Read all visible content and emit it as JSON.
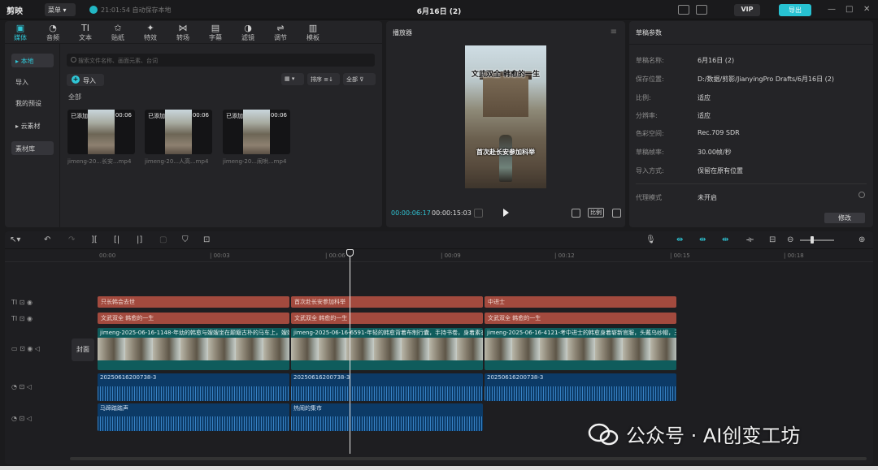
{
  "app": {
    "logo": "剪映",
    "menu": "菜单",
    "save_status": "21:01:54 自动保存本地",
    "title": "6月16日 (2)",
    "vip": "VIP",
    "export": "导出",
    "minimize": "—",
    "maximize": "□",
    "close": "✕"
  },
  "tools": [
    {
      "label": "媒体",
      "icon": "▣"
    },
    {
      "label": "音频",
      "icon": "◔"
    },
    {
      "label": "文本",
      "icon": "TI"
    },
    {
      "label": "贴纸",
      "icon": "✩"
    },
    {
      "label": "特效",
      "icon": "✦"
    },
    {
      "label": "转场",
      "icon": "⋈"
    },
    {
      "label": "字幕",
      "icon": "▤"
    },
    {
      "label": "滤镜",
      "icon": "◑"
    },
    {
      "label": "调节",
      "icon": "⇌"
    },
    {
      "label": "模板",
      "icon": "▥"
    }
  ],
  "sidebar": {
    "local": "本地",
    "import": "导入",
    "presets": "我的预设",
    "cloud": "云素材",
    "library": "素材库"
  },
  "media": {
    "search_placeholder": "搜索文件名称、画面元素、台词",
    "import_btn": "导入",
    "sort": "排序",
    "all_filter": "全部",
    "category": "全部",
    "clips": [
      {
        "added": "已添加",
        "duration": "00:06",
        "name": "jimeng-20...长安...mp4"
      },
      {
        "added": "已添加",
        "duration": "00:06",
        "name": "jimeng-20...人高...mp4"
      },
      {
        "added": "已添加",
        "duration": "00:06",
        "name": "jimeng-20...闹哄...mp4"
      }
    ]
  },
  "player": {
    "title": "播放器",
    "overlay_title": "文武双全  韩愈的一生",
    "overlay_sub": "首次赴长安参加科举",
    "current_time": "00:00:06:17",
    "total_time": "00:00:15:03",
    "ratio": "比例"
  },
  "draft": {
    "title": "草稿参数",
    "rows": [
      {
        "label": "草稿名称:",
        "value": "6月16日 (2)"
      },
      {
        "label": "保存位置:",
        "value": "D:/数据/剪影/JianyingPro Drafts/6月16日 (2)"
      },
      {
        "label": "比例:",
        "value": "适应"
      },
      {
        "label": "分辨率:",
        "value": "适应"
      },
      {
        "label": "色彩空间:",
        "value": "Rec.709 SDR"
      },
      {
        "label": "草稿帧率:",
        "value": "30.00帧/秒"
      },
      {
        "label": "导入方式:",
        "value": "保留在原有位置"
      }
    ],
    "proxy_label": "代理模式",
    "proxy_value": "未开启",
    "modify_btn": "修改"
  },
  "timeline": {
    "ticks": [
      "00:00",
      "| 00:03",
      "| 00:06",
      "| 00:09",
      "| 00:12",
      "| 00:15",
      "| 00:18"
    ],
    "cover": "封面",
    "text_track_1": [
      "只长韩会去世",
      "首次赴长安参加科举",
      "中进士"
    ],
    "text_track_2": [
      "文武双全  韩愈的一生",
      "文武双全  韩愈的一生",
      "文武双全  韩愈的一生"
    ],
    "video_clips": [
      "jimeng-2025-06-16-1148-年幼的韩愈与嫂嫂坐在颠簸古朴的马车上，嫂嫂",
      "jimeng-2025-06-16-6591-年轻的韩愈背着布制行囊，手持书卷，身着素衣",
      "jimeng-2025-06-16-4121-考中进士的韩愈身着崭新官服，头戴乌纱帽，玉"
    ],
    "audio_clips": [
      "20250616200738-3",
      "20250616200738-3",
      "20250616200738-3"
    ],
    "sfx_clips": [
      "马蹄踏踏声",
      "热闹的集市"
    ]
  },
  "watermark": "公众号 · AI创变工坊",
  "colors": {
    "accent": "#2fc6d6",
    "text_clip": "#a34a3e",
    "video_clip": "#0f5c5c",
    "audio_clip": "#0c3a66"
  }
}
